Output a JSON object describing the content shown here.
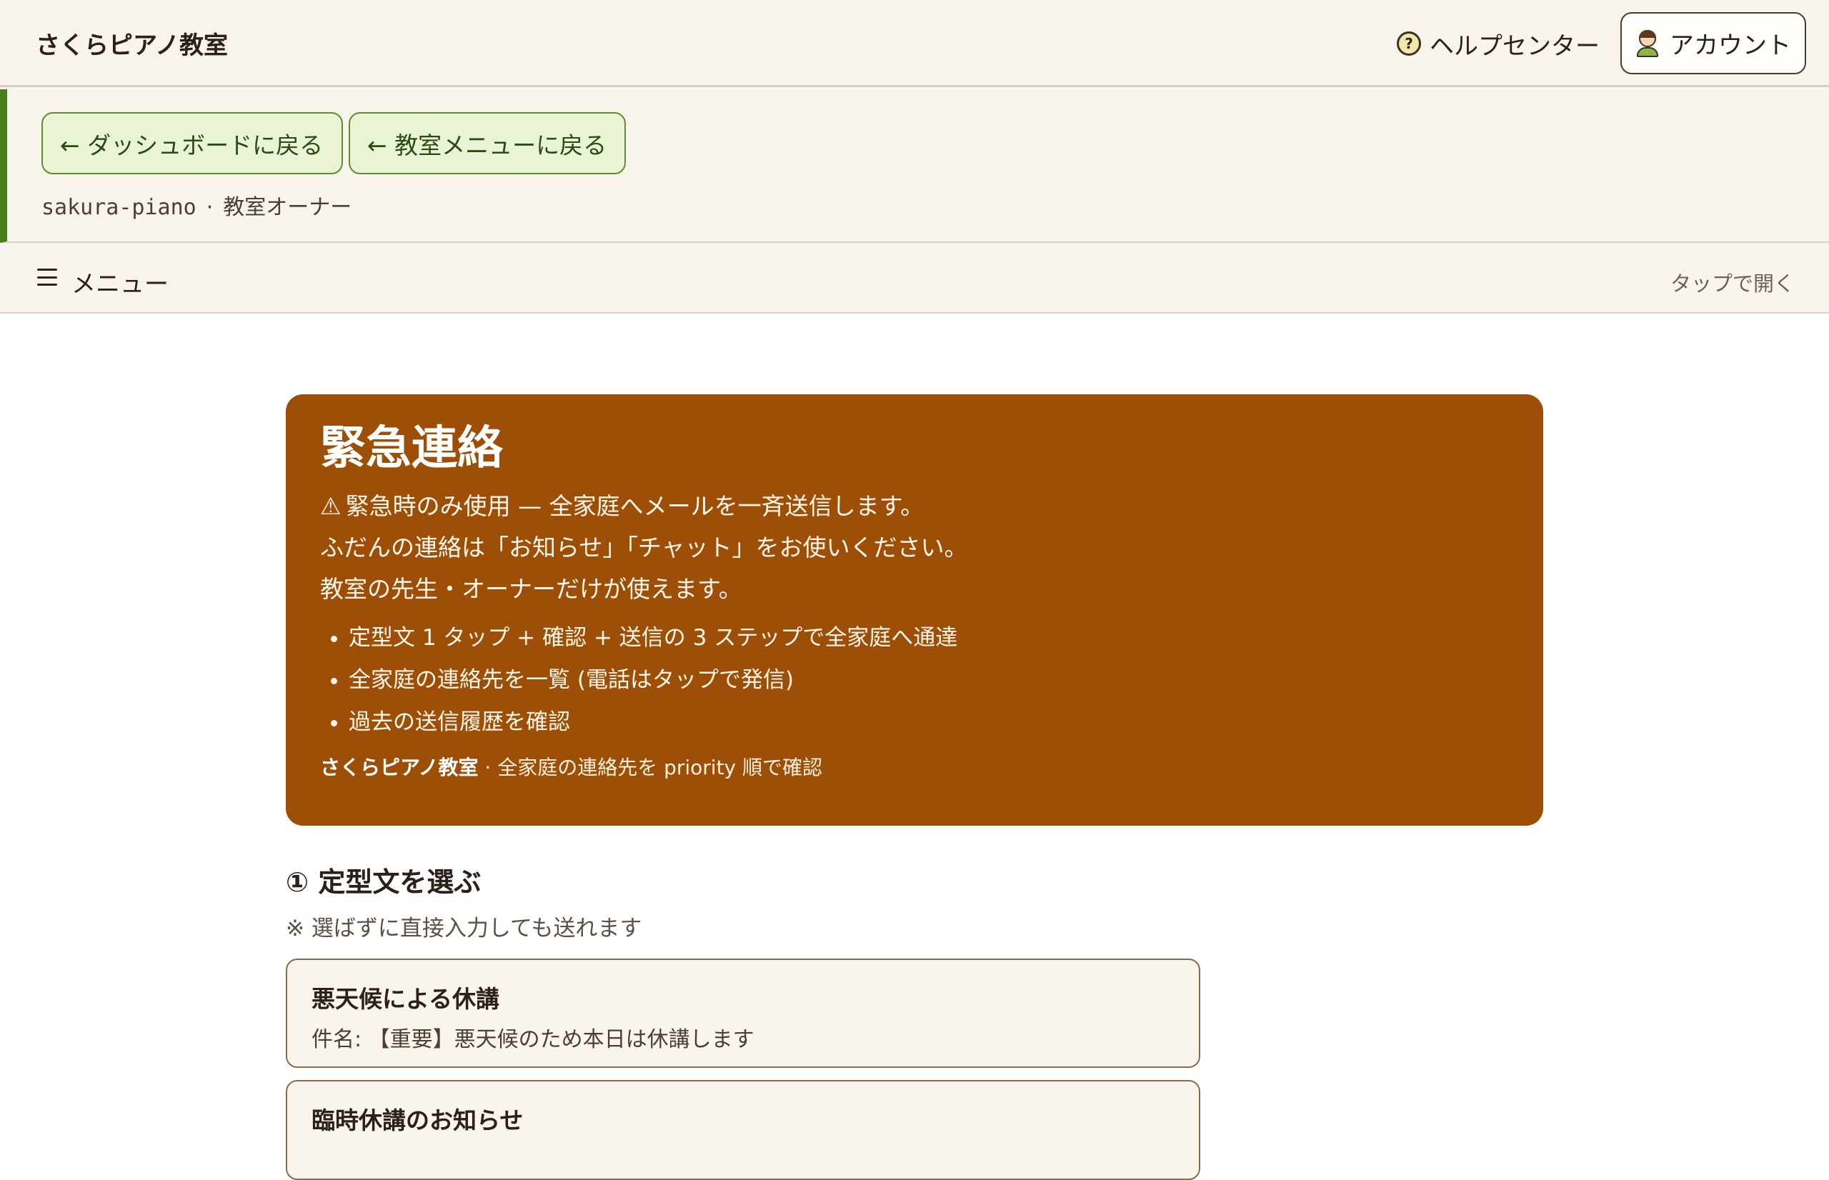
{
  "header": {
    "brand": "さくらピアノ教室",
    "help_label": "ヘルプセンター",
    "account_label": "アカウント"
  },
  "context": {
    "back_dashboard": "← ダッシュボードに戻る",
    "back_menu": "← 教室メニューに戻る",
    "slug": "sakura-piano",
    "separator": "·",
    "role": "教室オーナー"
  },
  "menubar": {
    "label": "メニュー",
    "hint": "タップで開く"
  },
  "alert": {
    "title": "緊急連絡",
    "warning_icon": "⚠",
    "line1": "緊急時のみ使用 — 全家庭へメールを一斉送信します。",
    "line2": "ふだんの連絡は「お知らせ」「チャット」をお使いください。",
    "line3": "教室の先生・オーナーだけが使えます。",
    "bullets": [
      "定型文 1 タップ + 確認 + 送信の 3 ステップで全家庭へ通達",
      "全家庭の連絡先を一覧 (電話はタップで発信)",
      "過去の送信履歴を確認"
    ],
    "footer_brand": "さくらピアノ教室",
    "footer_text": "· 全家庭の連絡先を priority 順で確認"
  },
  "templates_section": {
    "title": "① 定型文を選ぶ",
    "note": "※ 選ばずに直接入力しても送れます",
    "items": [
      {
        "title": "悪天候による休講",
        "subject": "件名: 【重要】悪天候のため本日は休講します"
      },
      {
        "title": "臨時休講のお知らせ",
        "subject": ""
      }
    ]
  },
  "colors": {
    "alert_bg": "#9e4f07",
    "accent_green": "#4a7d1c",
    "button_green_bg": "#e8f4d4"
  }
}
